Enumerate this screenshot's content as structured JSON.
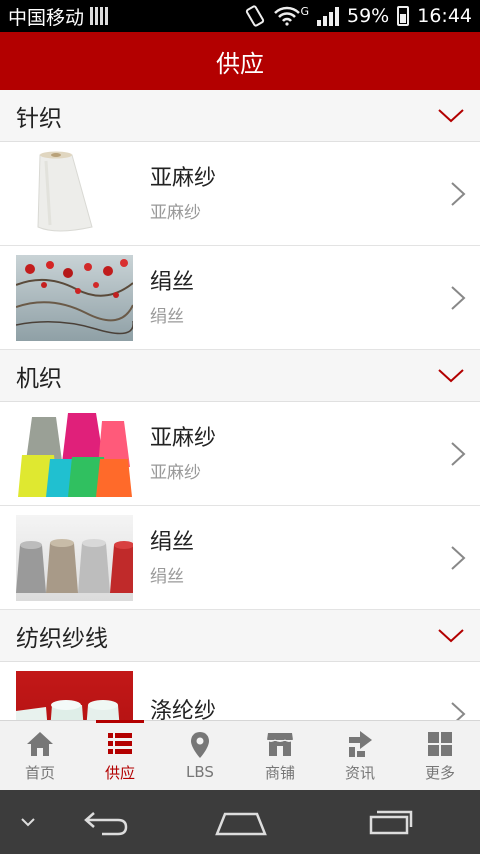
{
  "status_bar": {
    "carrier": "中国移动",
    "network": "G",
    "battery": "59%",
    "time": "16:44"
  },
  "header": {
    "title": "供应"
  },
  "sections": [
    {
      "title": "针织",
      "items": [
        {
          "name": "亚麻纱",
          "sub": "亚麻纱"
        },
        {
          "name": "绢丝",
          "sub": "绢丝"
        }
      ]
    },
    {
      "title": "机织",
      "items": [
        {
          "name": "亚麻纱",
          "sub": "亚麻纱"
        },
        {
          "name": "绢丝",
          "sub": "绢丝"
        }
      ]
    },
    {
      "title": "纺织纱线",
      "items": [
        {
          "name": "涤纶纱",
          "sub": ""
        }
      ]
    }
  ],
  "tabs": [
    {
      "label": "首页",
      "icon": "home-icon"
    },
    {
      "label": "供应",
      "icon": "list-icon",
      "active": true
    },
    {
      "label": "LBS",
      "icon": "location-pin-icon"
    },
    {
      "label": "商铺",
      "icon": "store-icon"
    },
    {
      "label": "资讯",
      "icon": "news-icon"
    },
    {
      "label": "更多",
      "icon": "grid-icon"
    }
  ],
  "colors": {
    "accent": "#b30000",
    "tab_inactive": "#777777",
    "nav_bg": "#3c3c3c"
  }
}
